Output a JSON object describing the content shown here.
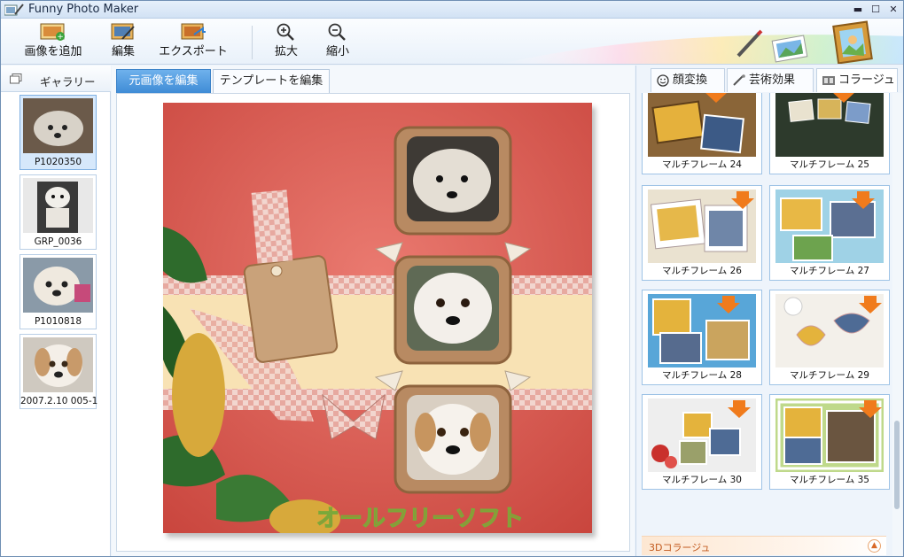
{
  "window": {
    "title": "Funny Photo Maker",
    "minimize": "▬",
    "maximize": "☐",
    "close": "✕"
  },
  "toolbar": {
    "add_image": "画像を追加",
    "edit": "編集",
    "export": "エクスポート",
    "zoom_in": "拡大",
    "zoom_out": "縮小"
  },
  "gallery": {
    "title": "ギャラリー",
    "items": [
      {
        "label": "P1020350",
        "selected": true
      },
      {
        "label": "GRP_0036",
        "selected": false
      },
      {
        "label": "P1010818",
        "selected": false
      },
      {
        "label": "2007.2.10 005-1",
        "selected": false
      }
    ]
  },
  "editor": {
    "tabs": [
      {
        "label": "元画像を編集",
        "active": true
      },
      {
        "label": "テンプレートを編集",
        "active": false
      }
    ],
    "watermark": "オールフリーソフト"
  },
  "right_panel": {
    "tabs": [
      {
        "label": "顔変換",
        "icon": "smiley-icon"
      },
      {
        "label": "芸術効果",
        "icon": "brush-icon"
      },
      {
        "label": "コラージュ",
        "icon": "film-icon",
        "active": true
      }
    ],
    "frames": [
      {
        "label": "マルチフレーム 24"
      },
      {
        "label": "マルチフレーム 25"
      },
      {
        "label": "マルチフレーム 26"
      },
      {
        "label": "マルチフレーム 27"
      },
      {
        "label": "マルチフレーム 28"
      },
      {
        "label": "マルチフレーム 29"
      },
      {
        "label": "マルチフレーム 30"
      },
      {
        "label": "マルチフレーム 35"
      }
    ],
    "section_3d": "3Dコラージュ"
  },
  "colors": {
    "accent": "#3f8cd6",
    "arrow": "#f07b1c",
    "collage_bg": "#d9584f"
  }
}
